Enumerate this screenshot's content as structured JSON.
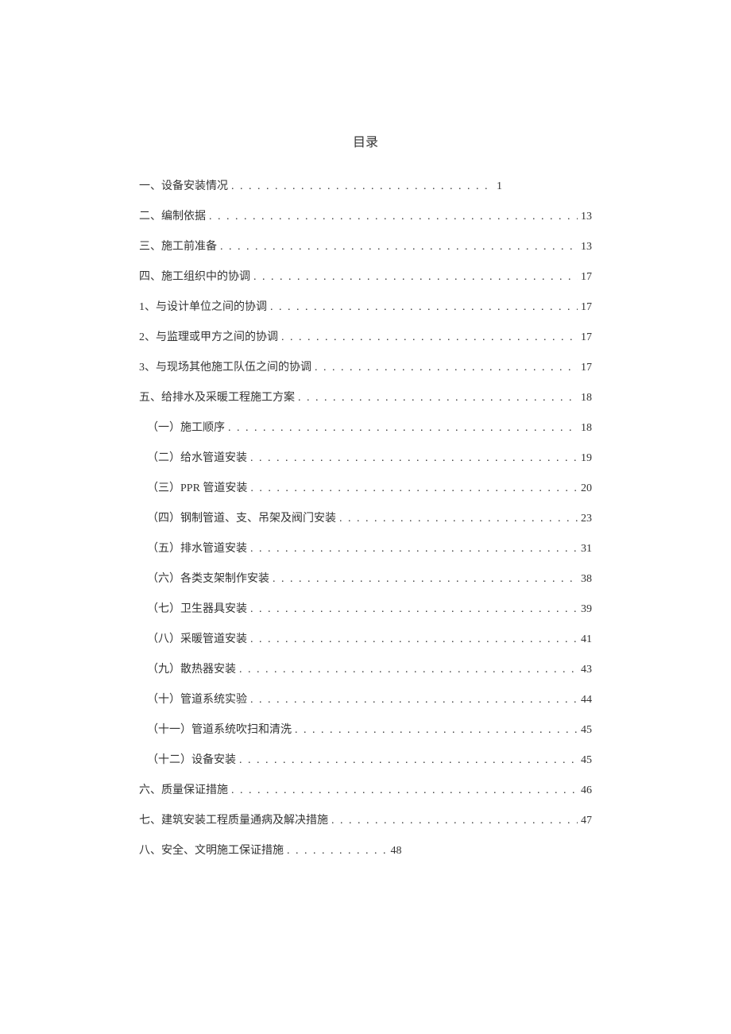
{
  "title": "目录",
  "entries": [
    {
      "label": "一、设备安装情况",
      "page": "1",
      "indent": false,
      "narrow": true
    },
    {
      "label": "二、编制依据",
      "page": "13",
      "indent": false
    },
    {
      "label": "三、施工前准备",
      "page": "13",
      "indent": false
    },
    {
      "label": "四、施工组织中的协调",
      "page": "17",
      "indent": false
    },
    {
      "label": "1、与设计单位之间的协调",
      "page": "17",
      "indent": false
    },
    {
      "label": "2、与监理或甲方之间的协调",
      "page": "17",
      "indent": false
    },
    {
      "label": "3、与现场其他施工队伍之间的协调",
      "page": "17",
      "indent": false
    },
    {
      "label": "五、给排水及采暖工程施工方案",
      "page": "18",
      "indent": false
    },
    {
      "label": "（一）施工顺序",
      "page": "18",
      "indent": true
    },
    {
      "label": "（二）给水管道安装",
      "page": "19",
      "indent": true
    },
    {
      "label": "（三）PPR 管道安装",
      "page": "20",
      "indent": true,
      "spaced": true
    },
    {
      "label": "（四）钢制管道、支、吊架及阀门安装",
      "page": "23",
      "indent": true
    },
    {
      "label": "（五）排水管道安装",
      "page": "31",
      "indent": true
    },
    {
      "label": "（六）各类支架制作安装",
      "page": "38",
      "indent": true
    },
    {
      "label": "（七）卫生器具安装",
      "page": "39",
      "indent": true
    },
    {
      "label": "（八）采暖管道安装",
      "page": "41",
      "indent": true
    },
    {
      "label": "（九）散热器安装",
      "page": "43",
      "indent": true
    },
    {
      "label": "（十）管道系统实验",
      "page": "44",
      "indent": true
    },
    {
      "label": "（十一）管道系统吹扫和清洗",
      "page": "45",
      "indent": true
    },
    {
      "label": "（十二）设备安装",
      "page": "45",
      "indent": true
    },
    {
      "label": "六、质量保证措施",
      "page": "46",
      "indent": false
    },
    {
      "label": "七、建筑安装工程质量通病及解决措施",
      "page": "47",
      "indent": false
    },
    {
      "label": "八、安全、文明施工保证措施",
      "page": "48",
      "indent": false,
      "short": true,
      "shortDots": ". . . . . . . . . . . ."
    }
  ]
}
